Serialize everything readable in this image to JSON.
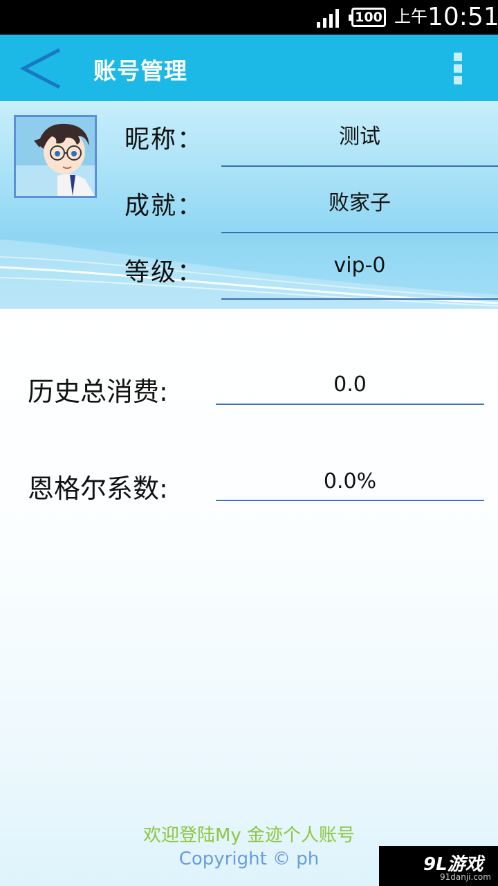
{
  "status_bar": {
    "battery": "100",
    "ampm": "上午",
    "time": "10:51",
    "icons": [
      "signal-icon",
      "battery-icon"
    ]
  },
  "action_bar": {
    "title": "账号管理",
    "back_icon": "back-chevron-icon",
    "menu_icon": "overflow-menu-icon",
    "color": "#1cb8e6"
  },
  "profile": {
    "nickname_label": "昵称：",
    "nickname_value": "测试",
    "achievement_label": "成就：",
    "achievement_value": "败家子",
    "level_label": "等级：",
    "level_value": "vip-0"
  },
  "stats": {
    "total_spend_label": "历史总消费:",
    "total_spend_value": "0.0",
    "engel_label": "恩格尔系数:",
    "engel_value": "0.0%"
  },
  "footer": {
    "welcome": "欢迎登陆My 金迹个人账号",
    "copyright": "Copyright © ph",
    "welcome_color": "#8cc63f",
    "copyright_color": "#6a9ce0"
  },
  "watermark": {
    "logo": "9L游戏",
    "url": "91danji.com"
  }
}
